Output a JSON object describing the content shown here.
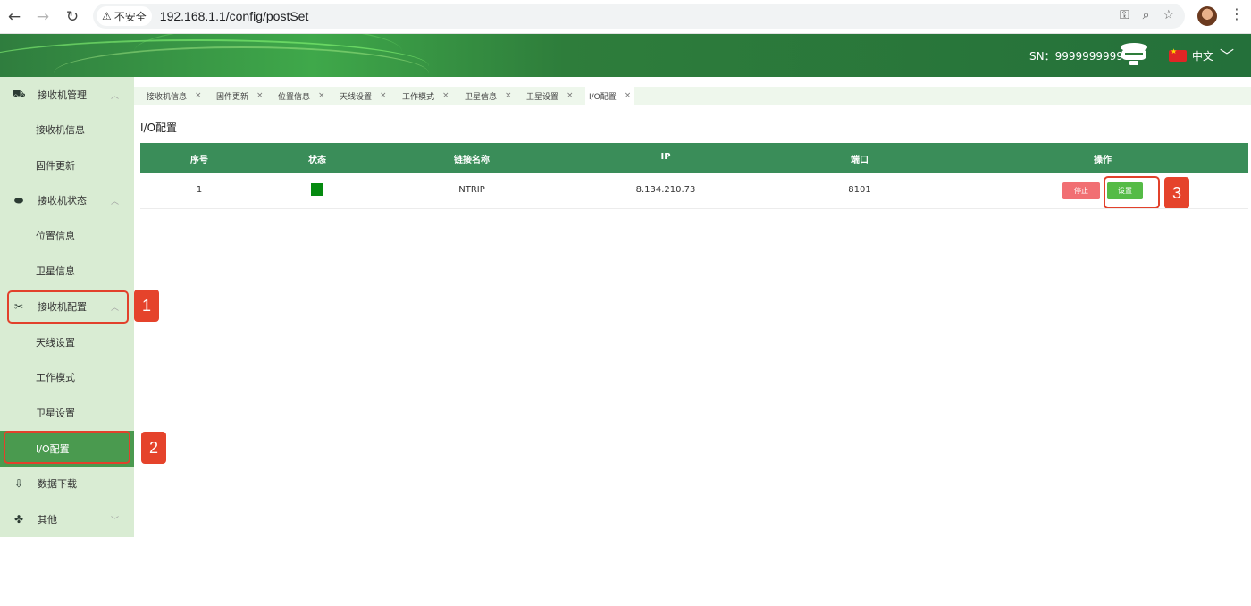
{
  "browser": {
    "security_label": "不安全",
    "url": "192.168.1.1/config/postSet"
  },
  "header": {
    "sn_label": "SN：9999999999",
    "language": "中文"
  },
  "sidebar": {
    "groups": [
      {
        "label": "接收机管理",
        "icon": "router-icon",
        "items": [
          "接收机信息",
          "固件更新"
        ]
      },
      {
        "label": "接收机状态",
        "icon": "receiver-icon",
        "items": [
          "位置信息",
          "卫星信息"
        ]
      },
      {
        "label": "接收机配置",
        "icon": "tools-icon",
        "items": [
          "天线设置",
          "工作模式",
          "卫星设置",
          "I/O配置"
        ]
      },
      {
        "label": "数据下载",
        "icon": "download-icon"
      },
      {
        "label": "其他",
        "icon": "grid-icon"
      }
    ],
    "active_item": "I/O配置"
  },
  "tabs": [
    "接收机信息",
    "固件更新",
    "位置信息",
    "天线设置",
    "工作模式",
    "卫星信息",
    "卫星设置",
    "I/O配置"
  ],
  "page": {
    "title": "I/O配置",
    "columns": [
      "序号",
      "状态",
      "链接名称",
      "IP",
      "端口",
      "操作"
    ],
    "rows": [
      {
        "index": "1",
        "status_color": "#058a10",
        "name": "NTRIP",
        "ip": "8.134.210.73",
        "port": "8101",
        "actions": [
          "停止",
          "设置"
        ]
      }
    ]
  },
  "annotations": [
    "1",
    "2",
    "3"
  ],
  "colors": {
    "header_green": "#2e7d3b",
    "sidebar_bg": "#d9ecd3",
    "table_head": "#3a8d59",
    "active_item": "#4a9a4f",
    "annotation_red": "#e2412b"
  }
}
